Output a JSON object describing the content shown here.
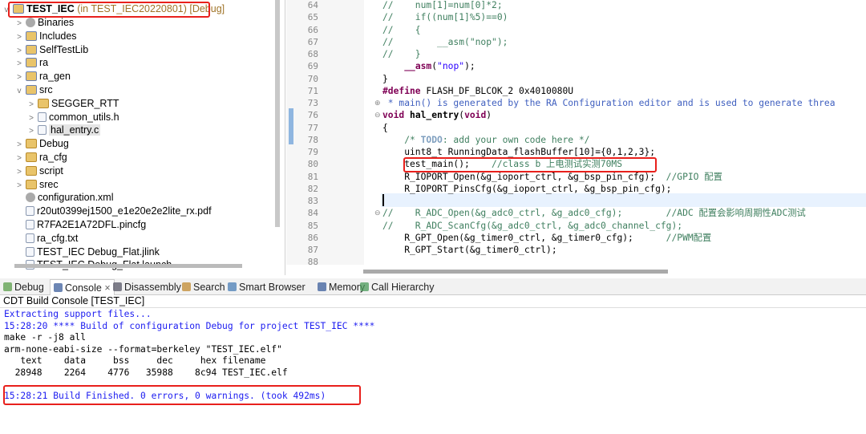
{
  "explorer": {
    "project": {
      "name": "TEST_IEC",
      "detail": "(in TEST_IEC20220801) [Debug]"
    },
    "items": [
      {
        "label": "Binaries",
        "icon": "binaries-icon",
        "depth": 1,
        "twisty": ">"
      },
      {
        "label": "Includes",
        "icon": "includes-icon",
        "depth": 1,
        "twisty": ">"
      },
      {
        "label": "SelfTestLib",
        "icon": "source-folder-icon",
        "depth": 1,
        "twisty": ">"
      },
      {
        "label": "ra",
        "icon": "source-folder-icon",
        "depth": 1,
        "twisty": ">"
      },
      {
        "label": "ra_gen",
        "icon": "source-folder-icon",
        "depth": 1,
        "twisty": ">"
      },
      {
        "label": "src",
        "icon": "source-folder-icon",
        "depth": 1,
        "twisty": "v"
      },
      {
        "label": "SEGGER_RTT",
        "icon": "folder-icon",
        "depth": 2,
        "twisty": ">"
      },
      {
        "label": "common_utils.h",
        "icon": "header-file-icon",
        "depth": 2,
        "twisty": ">"
      },
      {
        "label": "hal_entry.c",
        "icon": "c-file-icon",
        "depth": 2,
        "twisty": ">",
        "selected": true
      },
      {
        "label": "Debug",
        "icon": "folder-icon",
        "depth": 1,
        "twisty": ">"
      },
      {
        "label": "ra_cfg",
        "icon": "folder-icon",
        "depth": 1,
        "twisty": ">"
      },
      {
        "label": "script",
        "icon": "folder-icon",
        "depth": 1,
        "twisty": ">"
      },
      {
        "label": "srec",
        "icon": "folder-icon",
        "depth": 1,
        "twisty": ">"
      },
      {
        "label": "configuration.xml",
        "icon": "gear-icon",
        "depth": 1,
        "twisty": ""
      },
      {
        "label": "r20ut0399ej1500_e1e20e2e2lite_rx.pdf",
        "icon": "file-icon",
        "depth": 1,
        "twisty": ""
      },
      {
        "label": "R7FA2E1A72DFL.pincfg",
        "icon": "file-icon",
        "depth": 1,
        "twisty": ""
      },
      {
        "label": "ra_cfg.txt",
        "icon": "file-icon",
        "depth": 1,
        "twisty": ""
      },
      {
        "label": "TEST_IEC Debug_Flat.jlink",
        "icon": "file-icon",
        "depth": 1,
        "twisty": ""
      },
      {
        "label": "TEST_IEC Debug_Flat.launch",
        "icon": "file-icon",
        "depth": 1,
        "twisty": ""
      }
    ]
  },
  "editor": {
    "lines": [
      {
        "n": "64",
        "segs": [
          [
            "cm",
            "//    num[1]=num[0]*2;"
          ]
        ]
      },
      {
        "n": "65",
        "segs": [
          [
            "cm",
            "//    if((num[1]%5)==0)"
          ]
        ]
      },
      {
        "n": "66",
        "segs": [
          [
            "cm",
            "//    {"
          ]
        ]
      },
      {
        "n": "67",
        "segs": [
          [
            "cm",
            "//        __asm(\"nop\");"
          ]
        ]
      },
      {
        "n": "68",
        "segs": [
          [
            "cm",
            "//    }"
          ]
        ]
      },
      {
        "n": "69",
        "segs": [
          [
            "",
            "    "
          ],
          [
            "kw",
            "__asm"
          ],
          [
            "",
            "("
          ],
          [
            "str",
            "\"nop\""
          ],
          [
            "",
            ");"
          ]
        ]
      },
      {
        "n": "70",
        "segs": [
          [
            "",
            "}"
          ]
        ]
      },
      {
        "n": "71",
        "segs": [
          [
            "pp",
            "#define"
          ],
          [
            "",
            " FLASH_DF_BLCOK_2 0x4010080U"
          ]
        ]
      },
      {
        "n": "73",
        "fold": "+",
        "segs": [
          [
            "doc",
            " * main() is generated by the RA Configuration editor and is used to generate threa"
          ]
        ]
      },
      {
        "n": "76",
        "fold": "-",
        "segs": [
          [
            "kw",
            "void"
          ],
          [
            "",
            " "
          ],
          [
            "fn",
            "hal_entry"
          ],
          [
            "",
            "("
          ],
          [
            "kw",
            "void"
          ],
          [
            "",
            ")"
          ]
        ]
      },
      {
        "n": "77",
        "segs": [
          [
            "",
            "{"
          ]
        ]
      },
      {
        "n": "78",
        "segs": [
          [
            "cm",
            "    /* "
          ],
          [
            "todo",
            "TODO"
          ],
          [
            "cm",
            ": add your own code here */"
          ]
        ]
      },
      {
        "n": "79",
        "segs": [
          [
            "",
            "    uint8_t RunningData_flashBuffer[10]={0,1,2,3};"
          ]
        ]
      },
      {
        "n": "80",
        "segs": [
          [
            "",
            "    test_main();    "
          ],
          [
            "cm",
            "//class b 上电测试实测70MS"
          ]
        ]
      },
      {
        "n": "81",
        "segs": [
          [
            "",
            "    R_IOPORT_Open(&g_ioport_ctrl, &g_bsp_pin_cfg);  "
          ],
          [
            "cm",
            "//GPIO 配置"
          ]
        ]
      },
      {
        "n": "82",
        "segs": [
          [
            "",
            "    R_IOPORT_PinsCfg(&g_ioport_ctrl, &g_bsp_pin_cfg);"
          ]
        ]
      },
      {
        "n": "83",
        "segs": [
          [
            "",
            ""
          ]
        ]
      },
      {
        "n": "84",
        "fold": "-",
        "segs": [
          [
            "cm",
            "//    R_ADC_Open(&g_adc0_ctrl, &g_adc0_cfg);        //ADC 配置会影响周期性ADC测试"
          ]
        ]
      },
      {
        "n": "85",
        "segs": [
          [
            "cm",
            "//    R_ADC_ScanCfg(&g_adc0_ctrl, &g_adc0_channel_cfg);"
          ]
        ]
      },
      {
        "n": "86",
        "segs": [
          [
            "",
            "    R_GPT_Open(&g_timer0_ctrl, &g_timer0_cfg);      "
          ],
          [
            "cm",
            "//PWM配置"
          ]
        ]
      },
      {
        "n": "87",
        "segs": [
          [
            "",
            "    R_GPT_Start(&g_timer0_ctrl);"
          ]
        ]
      },
      {
        "n": "88",
        "segs": [
          [
            "",
            ""
          ]
        ]
      }
    ]
  },
  "tabs": [
    {
      "label": "Debug",
      "icon": "debug-icon"
    },
    {
      "label": "Console",
      "icon": "console-icon",
      "active": true,
      "close": "×"
    },
    {
      "label": "Disassembly",
      "icon": "disassembly-icon"
    },
    {
      "label": "Search",
      "icon": "search-icon"
    },
    {
      "label": "Smart Browser",
      "icon": "smart-browser-icon"
    },
    {
      "label": "Memory",
      "icon": "memory-icon"
    },
    {
      "label": "Call Hierarchy",
      "icon": "call-hierarchy-icon"
    }
  ],
  "console": {
    "title": "CDT Build Console [TEST_IEC]",
    "lines": [
      {
        "text": "Extracting support files...",
        "color": "blue"
      },
      {
        "text": "15:28:20 **** Build of configuration Debug for project TEST_IEC ****",
        "color": "blue"
      },
      {
        "text": "make -r -j8 all",
        "color": ""
      },
      {
        "text": "arm-none-eabi-size --format=berkeley \"TEST_IEC.elf\"",
        "color": ""
      },
      {
        "text": "   text    data     bss     dec     hex filename",
        "color": ""
      },
      {
        "text": "  28948    2264    4776   35988    8c94 TEST_IEC.elf",
        "color": ""
      },
      {
        "text": "",
        "color": ""
      },
      {
        "text": "15:28:21 Build Finished. 0 errors, 0 warnings. (took 492ms)",
        "color": "blue"
      }
    ]
  },
  "colors": {
    "highlight_box": "#e8201c",
    "console_blue": "#1c1cf0",
    "comment": "#3f7f5f",
    "keyword": "#7f0055"
  }
}
